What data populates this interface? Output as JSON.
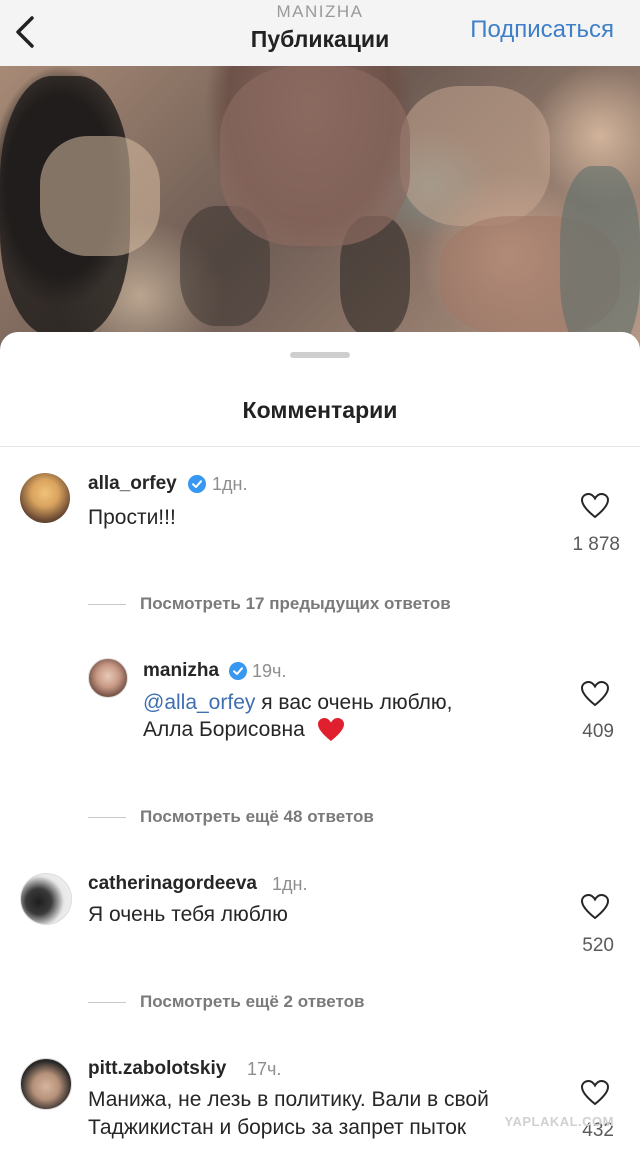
{
  "header": {
    "account": "MANIZHA",
    "title": "Публикации",
    "follow_label": "Подписаться"
  },
  "sheet": {
    "title": "Комментарии"
  },
  "comments": [
    {
      "username": "alla_orfey",
      "verified": true,
      "time": "1дн.",
      "text": "Прости!!!",
      "likes": "1 878",
      "view_replies": "Посмотреть 17 предыдущих ответов"
    },
    {
      "username": "manizha",
      "verified": true,
      "time": "19ч.",
      "mention": "@alla_orfey",
      "text_line1": "я вас очень люблю,",
      "text_line2": "Алла Борисовна",
      "emoji": "red-heart",
      "likes": "409",
      "view_replies": "Посмотреть ещё 48 ответов"
    },
    {
      "username": "catherinagordeeva",
      "verified": false,
      "time": "1дн.",
      "text": "Я очень тебя люблю",
      "likes": "520",
      "view_replies": "Посмотреть ещё 2 ответов"
    },
    {
      "username": "pitt.zabolotskiy",
      "verified": false,
      "time": "17ч.",
      "text_line1": "Манижа, не лезь в политику. Вали в свой",
      "text_line2": "Таджикистан и борись за запрет пыток",
      "likes": "432"
    }
  ],
  "watermark": "YAPLAKAL.COM",
  "colors": {
    "accent_blue": "#3f7fc7",
    "verified_blue": "#3897f0",
    "heart_red": "#e0202e",
    "header_bg": "#f4f4f4"
  }
}
